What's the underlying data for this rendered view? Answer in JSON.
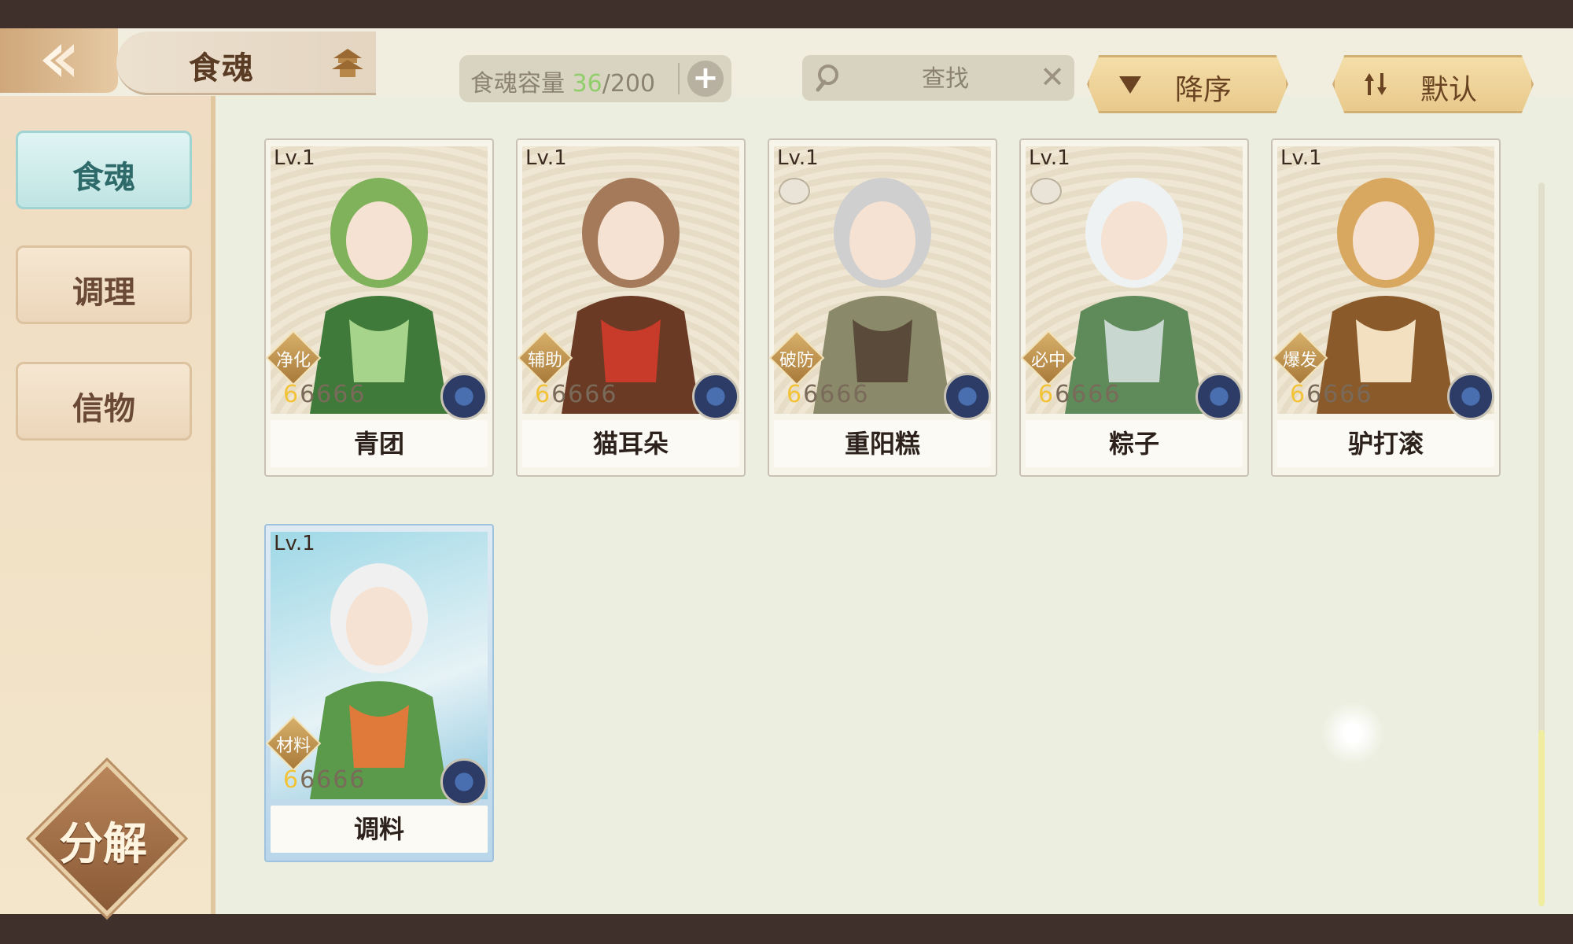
{
  "header": {
    "title": "食魂",
    "capacity_label": "食魂容量",
    "capacity_current": "36",
    "capacity_max": "/200",
    "plus": "+",
    "search_placeholder": "查找",
    "clear": "✕",
    "sort_order_label": "降序",
    "sort_mode_label": "默认"
  },
  "sidebar": {
    "tabs": [
      {
        "label": "食魂",
        "active": true
      },
      {
        "label": "调理",
        "active": false
      },
      {
        "label": "信物",
        "active": false
      }
    ],
    "decompose_label": "分解"
  },
  "cards": [
    {
      "level": "Lv.1",
      "role": "净化",
      "name": "青团",
      "stars": "66666",
      "dish": false,
      "theme": "green"
    },
    {
      "level": "Lv.1",
      "role": "辅助",
      "name": "猫耳朵",
      "stars": "66666",
      "dish": false,
      "theme": "brown"
    },
    {
      "level": "Lv.1",
      "role": "破防",
      "name": "重阳糕",
      "stars": "66666",
      "dish": true,
      "theme": "grey"
    },
    {
      "level": "Lv.1",
      "role": "必中",
      "name": "粽子",
      "stars": "66666",
      "dish": true,
      "theme": "white"
    },
    {
      "level": "Lv.1",
      "role": "爆发",
      "name": "驴打滚",
      "stars": "66666",
      "dish": false,
      "theme": "gold"
    },
    {
      "level": "Lv.1",
      "role": "材料",
      "name": "调料",
      "stars": "66666",
      "dish": false,
      "theme": "blue"
    }
  ],
  "colors": {
    "accent_green": "#8fce6a",
    "active_tab": "#bfe4e3",
    "button_gold": "#e9c98c",
    "background": "#ecefe0"
  },
  "icons": [
    "back-arrow-icon",
    "pagoda-icon",
    "search-icon",
    "close-icon",
    "sort-down-icon",
    "sort-toggle-icon",
    "flower-emblem-icon"
  ]
}
